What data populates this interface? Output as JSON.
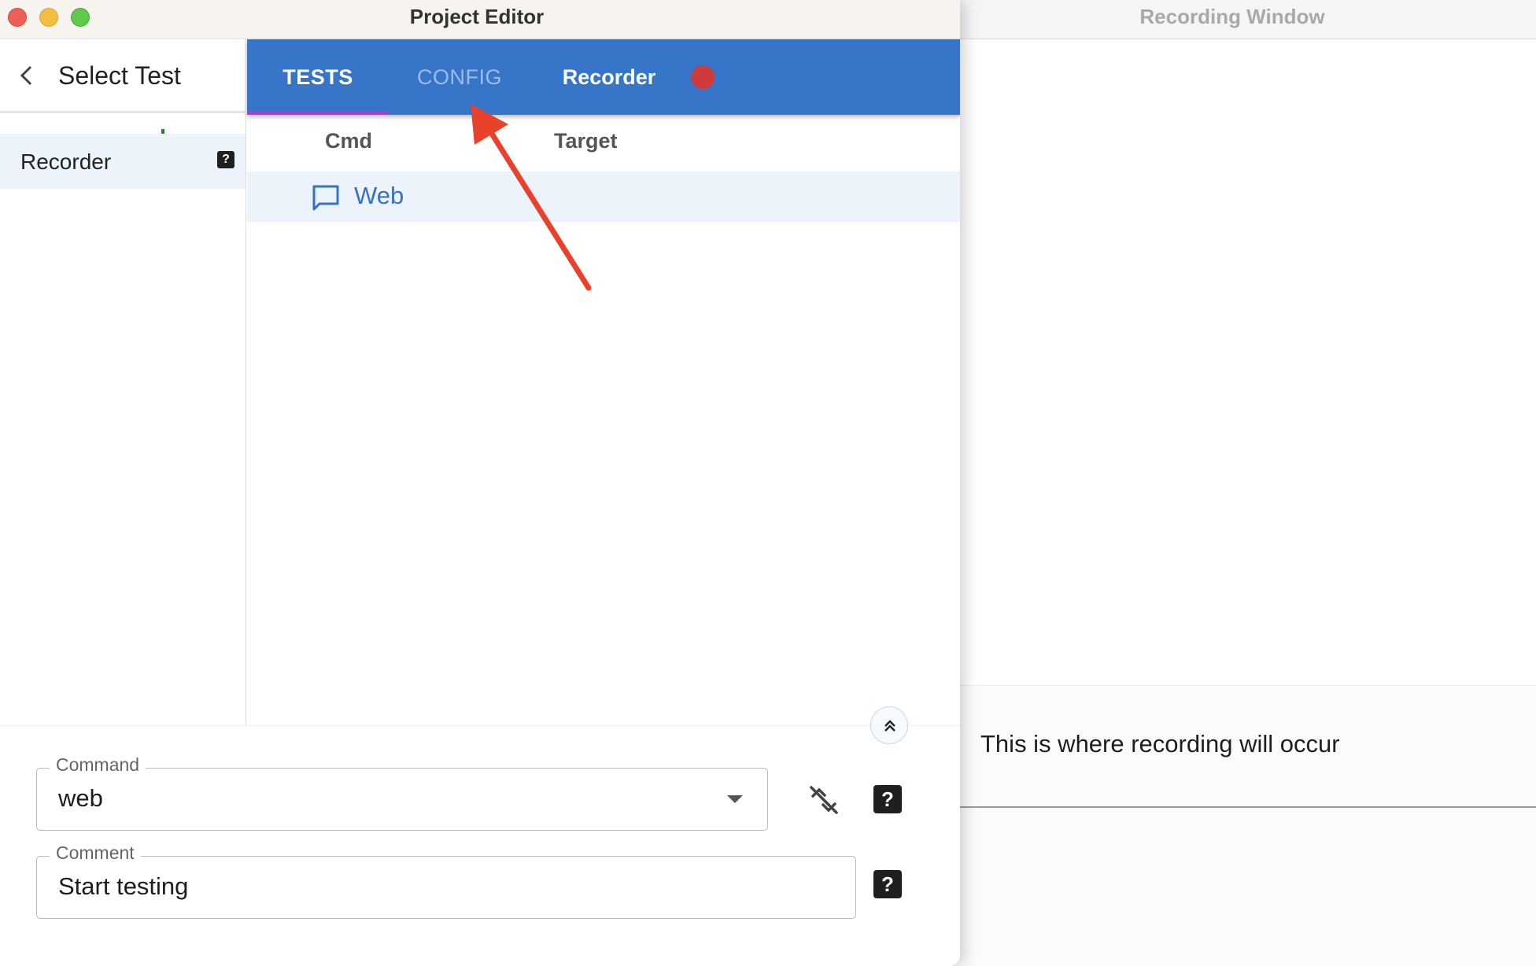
{
  "recording_window": {
    "title": "Recording Window",
    "message": "This is where recording will occur"
  },
  "project_editor": {
    "title": "Project Editor",
    "sidebar": {
      "header_label": "Select Test",
      "items": [
        {
          "label": "Recorder",
          "help": "?"
        }
      ]
    },
    "tabs": [
      {
        "label": "TESTS",
        "active": true
      },
      {
        "label": "CONFIG",
        "active": false
      },
      {
        "label": "Recorder",
        "active": false
      }
    ],
    "table": {
      "columns": [
        "Cmd",
        "Target"
      ],
      "rows": [
        {
          "cmd": "Web",
          "target": ""
        }
      ]
    },
    "form": {
      "command": {
        "label": "Command",
        "value": "web"
      },
      "comment": {
        "label": "Comment",
        "value": "Start testing"
      },
      "help": "?"
    }
  },
  "colors": {
    "tab_bar": "#3675c8",
    "tab_indicator": "#a83fcf",
    "record_dot": "#d03a3a",
    "add": "#2e7d32",
    "remove": "#e06b1f",
    "annotation_arrow": "#e8412c",
    "link": "#3672c4"
  },
  "icons": {
    "back": "chevron-left-icon",
    "add": "plus-icon",
    "remove": "minus-icon",
    "command_row": "comment-icon",
    "collapse": "double-chevron-up-icon",
    "dropdown": "caret-down-icon",
    "link_off": "link-off-icon",
    "help": "help-icon"
  }
}
